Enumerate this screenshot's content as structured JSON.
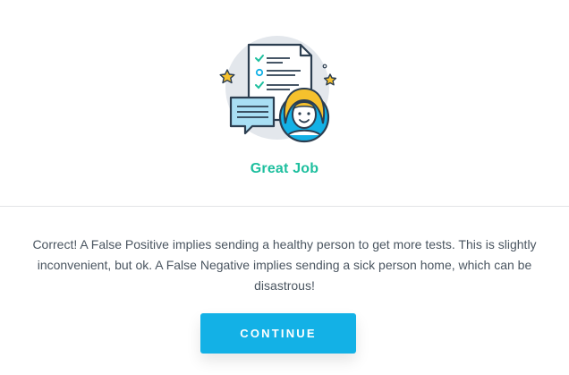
{
  "result": {
    "title": "Great Job",
    "illustration_icon": "checklist-avatar-illustration"
  },
  "feedback": {
    "text": "Correct! A False Positive implies sending a healthy person to get more tests. This is slightly inconvenient, but ok. A False Negative implies sending a sick person home, which can be disastrous!"
  },
  "actions": {
    "continue_label": "CONTINUE"
  },
  "colors": {
    "accent_green": "#1dbf9e",
    "button_blue": "#13b1e6"
  }
}
